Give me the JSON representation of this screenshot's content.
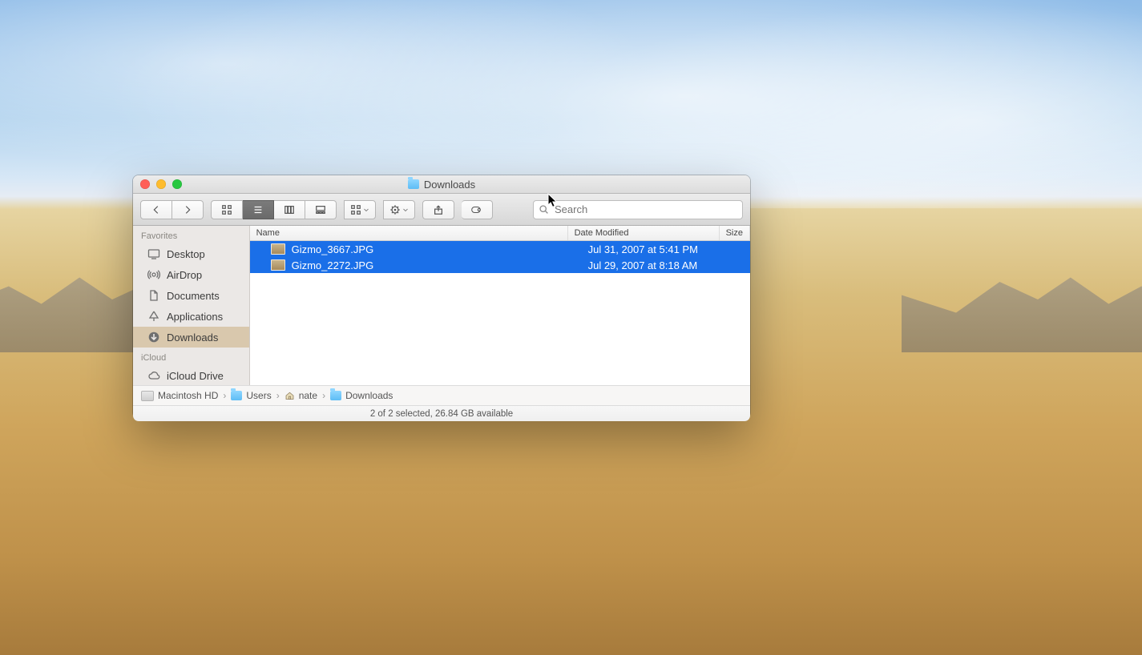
{
  "window": {
    "title": "Downloads"
  },
  "search": {
    "placeholder": "Search",
    "value": ""
  },
  "sidebar": {
    "sections": [
      {
        "header": "Favorites",
        "items": [
          {
            "icon": "desktop-icon",
            "label": "Desktop"
          },
          {
            "icon": "airdrop-icon",
            "label": "AirDrop"
          },
          {
            "icon": "documents-icon",
            "label": "Documents"
          },
          {
            "icon": "applications-icon",
            "label": "Applications"
          },
          {
            "icon": "downloads-icon",
            "label": "Downloads",
            "selected": true
          }
        ]
      },
      {
        "header": "iCloud",
        "items": [
          {
            "icon": "cloud-icon",
            "label": "iCloud Drive"
          }
        ]
      }
    ]
  },
  "columns": {
    "name": "Name",
    "date": "Date Modified",
    "size": "Size"
  },
  "files": [
    {
      "name": "Gizmo_3667.JPG",
      "date": "Jul 31, 2007 at 5:41 PM",
      "selected": true
    },
    {
      "name": "Gizmo_2272.JPG",
      "date": "Jul 29, 2007 at 8:18 AM",
      "selected": true
    }
  ],
  "path": [
    {
      "icon": "hd-icon",
      "label": "Macintosh HD"
    },
    {
      "icon": "folder-icon",
      "label": "Users"
    },
    {
      "icon": "home-icon",
      "label": "nate"
    },
    {
      "icon": "folder-icon",
      "label": "Downloads"
    }
  ],
  "status": "2 of 2 selected, 26.84 GB available"
}
